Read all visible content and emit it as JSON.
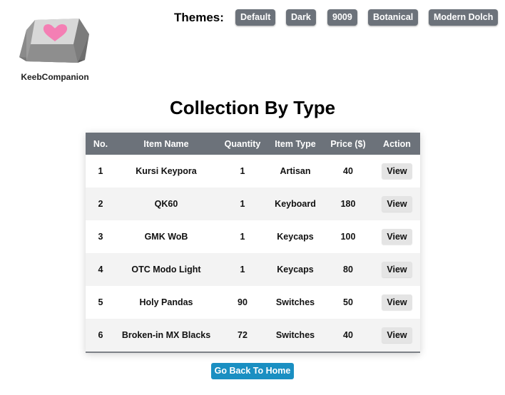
{
  "logo": {
    "text": "KeebCompanion",
    "icon": "keycap-heart-icon"
  },
  "themes": {
    "label": "Themes:",
    "options": [
      "Default",
      "Dark",
      "9009",
      "Botanical",
      "Modern Dolch"
    ]
  },
  "page_title": "Collection By Type",
  "table": {
    "headers": [
      "No.",
      "Item Name",
      "Quantity",
      "Item Type",
      "Price ($)",
      "Action"
    ],
    "rows": [
      {
        "no": "1",
        "name": "Kursi Keypora",
        "quantity": "1",
        "type": "Artisan",
        "price": "40",
        "action": "View"
      },
      {
        "no": "2",
        "name": "QK60",
        "quantity": "1",
        "type": "Keyboard",
        "price": "180",
        "action": "View"
      },
      {
        "no": "3",
        "name": "GMK WoB",
        "quantity": "1",
        "type": "Keycaps",
        "price": "100",
        "action": "View"
      },
      {
        "no": "4",
        "name": "OTC Modo Light",
        "quantity": "1",
        "type": "Keycaps",
        "price": "80",
        "action": "View"
      },
      {
        "no": "5",
        "name": "Holy Pandas",
        "quantity": "90",
        "type": "Switches",
        "price": "50",
        "action": "View"
      },
      {
        "no": "6",
        "name": "Broken-in MX Blacks",
        "quantity": "72",
        "type": "Switches",
        "price": "40",
        "action": "View"
      }
    ]
  },
  "back_button": "Go Back To Home",
  "colors": {
    "header_bg": "#6c727a",
    "theme_button_bg": "#6c727a",
    "back_button_bg": "#1a8fc2",
    "heart": "#f47fb4"
  }
}
